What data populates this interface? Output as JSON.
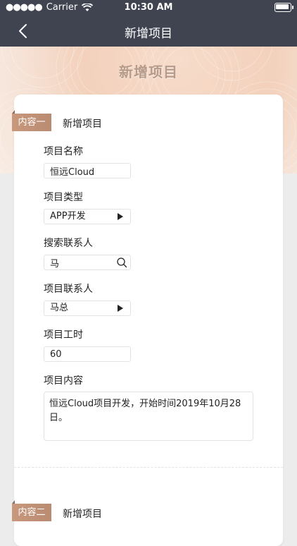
{
  "status_bar": {
    "carrier": "Carrier",
    "time": "10:30 AM"
  },
  "nav": {
    "title": "新增项目"
  },
  "hero": {
    "title": "新增项目"
  },
  "sections": [
    {
      "tag": "内容一",
      "label": "新增项目",
      "fields": {
        "name": {
          "label": "项目名称",
          "value": "恒远Cloud"
        },
        "type": {
          "label": "项目类型",
          "value": "APP开发"
        },
        "search_contact": {
          "label": "搜索联系人",
          "value": "马"
        },
        "contact": {
          "label": "项目联系人",
          "value": "马总"
        },
        "hours": {
          "label": "项目工时",
          "value": "60"
        },
        "content": {
          "label": "项目内容",
          "value": "恒远Cloud项目开发，开始时间2019年10月28日。"
        }
      }
    },
    {
      "tag": "内容二",
      "label": "新增项目"
    }
  ],
  "colors": {
    "nav_bg": "#3f4450",
    "tag_bg": "#c9987d",
    "page_bg": "#ececec"
  }
}
